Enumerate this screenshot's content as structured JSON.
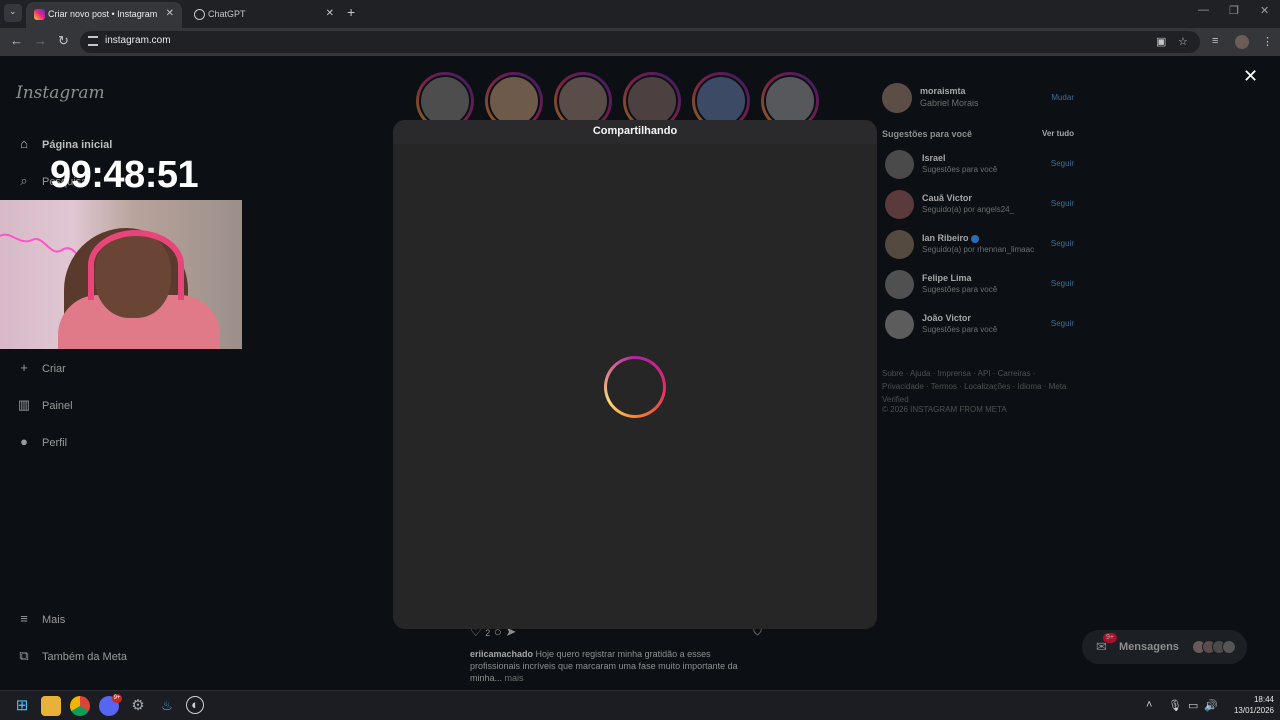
{
  "browser": {
    "tabs": [
      {
        "title": "Criar novo post • Instagram",
        "active": true
      },
      {
        "title": "ChatGPT",
        "active": false
      }
    ],
    "tab_close": "✕",
    "new_tab": "+",
    "window": {
      "minimize": "—",
      "restore": "❐",
      "close": "✕"
    },
    "url": "instagram.com",
    "nav": {
      "back": "←",
      "forward": "→",
      "reload": "↻"
    },
    "toolbar_icons": {
      "install": "▣",
      "bookmark": "☆",
      "media": "≡",
      "menu": "⋮"
    }
  },
  "instagram": {
    "logo": "Instagram",
    "nav": [
      {
        "label": "Página inicial",
        "icon": "home-icon",
        "glyph": "⌂"
      },
      {
        "label": "Pesquisa",
        "icon": "search-icon",
        "glyph": "⌕"
      },
      {
        "label": "Criar",
        "icon": "plus-icon",
        "glyph": "+"
      },
      {
        "label": "Painel",
        "icon": "chart-icon",
        "glyph": "▥"
      },
      {
        "label": "Perfil",
        "icon": "avatar-icon",
        "glyph": "●"
      },
      {
        "label": "Mais",
        "icon": "menu-icon",
        "glyph": "≡"
      },
      {
        "label": "Também da Meta",
        "icon": "meta-icon",
        "glyph": "⧉"
      }
    ],
    "stories_count": 6,
    "rail": {
      "username": "moraismta",
      "fullname": "Gabriel Morais",
      "switch": "Mudar",
      "suggestions_title": "Sugestões para você",
      "see_all": "Ver tudo",
      "suggestions": [
        {
          "name": "Israel",
          "sub": "Sugestões para você",
          "action": "Seguir"
        },
        {
          "name": "Cauã Victor",
          "sub": "Seguido(a) por angels24_",
          "action": "Seguir"
        },
        {
          "name": "Ian Ribeiro",
          "sub": "Seguido(a) por rhennan_limaac",
          "action": "Seguir"
        },
        {
          "name": "Felipe Lima",
          "sub": "Sugestões para você",
          "action": "Seguir"
        },
        {
          "name": "João Victor",
          "sub": "Sugestões para você",
          "action": "Seguir"
        }
      ],
      "footer": "Sobre · Ajuda · Imprensa · API · Carreiras · Privacidade · Termos · Localizações · Idioma · Meta Verified",
      "copyright": "© 2026 INSTAGRAM FROM META"
    },
    "post": {
      "likes": "2",
      "author": "eriicamachado",
      "caption": "Hoje quero registrar minha gratidão a esses profissionais incríveis que marcaram uma fase muito importante da minha...",
      "more": "mais"
    },
    "messages": {
      "label": "Mensagens",
      "badge": "9+"
    },
    "close_glyph": "✕"
  },
  "overlay": {
    "timer": "99:48:51"
  },
  "modal": {
    "title": "Compartilhando"
  },
  "taskbar": {
    "apps": [
      "windows-start",
      "file-explorer",
      "chrome",
      "discord",
      "settings",
      "steam",
      "obs"
    ],
    "discord_badge": "9+",
    "time": "18:44",
    "date": "13/01/2026"
  }
}
